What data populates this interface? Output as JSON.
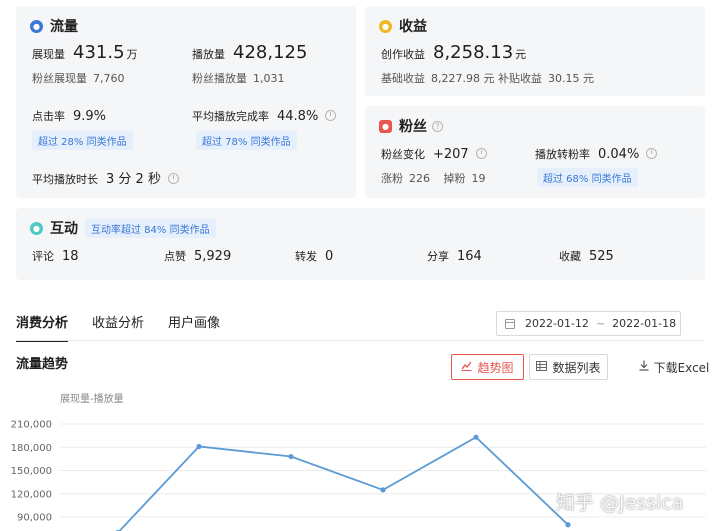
{
  "traffic": {
    "title": "流量",
    "impressions": {
      "label": "展现量",
      "value": "431.5",
      "unit": "万"
    },
    "plays": {
      "label": "播放量",
      "value": "428,125"
    },
    "fan_impressions": {
      "label": "粉丝展现量",
      "value": "7,760"
    },
    "fan_plays": {
      "label": "粉丝播放量",
      "value": "1,031"
    },
    "ctr": {
      "label": "点击率",
      "value": "9.9%",
      "badge": "超过 28% 同类作品"
    },
    "completion": {
      "label": "平均播放完成率",
      "value": "44.8%",
      "badge": "超过 78% 同类作品"
    },
    "avg_duration": {
      "label": "平均播放时长",
      "value": "3 分 2 秒"
    }
  },
  "income": {
    "title": "收益",
    "creation": {
      "label": "创作收益",
      "value": "8,258.13",
      "unit": "元"
    },
    "base": {
      "label": "基础收益",
      "value": "8,227.98 元"
    },
    "subsidy": {
      "label": "补贴收益",
      "value": "30.15 元"
    }
  },
  "fans": {
    "title": "粉丝",
    "change": {
      "label": "粉丝变化",
      "value": "+207"
    },
    "gain": {
      "label": "涨粉",
      "value": "226"
    },
    "loss": {
      "label": "掉粉",
      "value": "19"
    },
    "conversion": {
      "label": "播放转粉率",
      "value": "0.04%",
      "badge": "超过 68% 同类作品"
    }
  },
  "interaction": {
    "title": "互动",
    "badge": "互动率超过 84% 同类作品",
    "comments": {
      "label": "评论",
      "value": "18"
    },
    "likes": {
      "label": "点赞",
      "value": "5,929"
    },
    "reposts": {
      "label": "转发",
      "value": "0"
    },
    "shares": {
      "label": "分享",
      "value": "164"
    },
    "favorites": {
      "label": "收藏",
      "value": "525"
    }
  },
  "tabs": [
    "消费分析",
    "收益分析",
    "用户画像"
  ],
  "date_range": {
    "start": "2022-01-12",
    "end": "2022-01-18",
    "separator": "~"
  },
  "section_title": "流量趋势",
  "buttons": {
    "trend": "趋势图",
    "list": "数据列表",
    "download": "下载Excel"
  },
  "watermark": "知乎 @Jessica",
  "colors": {
    "accent_red": "#e6564e",
    "line_blue": "#5b9bd5",
    "badge_blue": "#3a78d6"
  },
  "chart_data": {
    "type": "line",
    "ylabel": "展现量-播放量",
    "yticks": [
      "210,000",
      "180,000",
      "150,000",
      "120,000",
      "90,000"
    ],
    "ylim": [
      90000,
      210000
    ],
    "series": [
      {
        "values": [
          70000,
          181000,
          168000,
          125000,
          193000,
          80000
        ]
      }
    ],
    "grid": true
  }
}
